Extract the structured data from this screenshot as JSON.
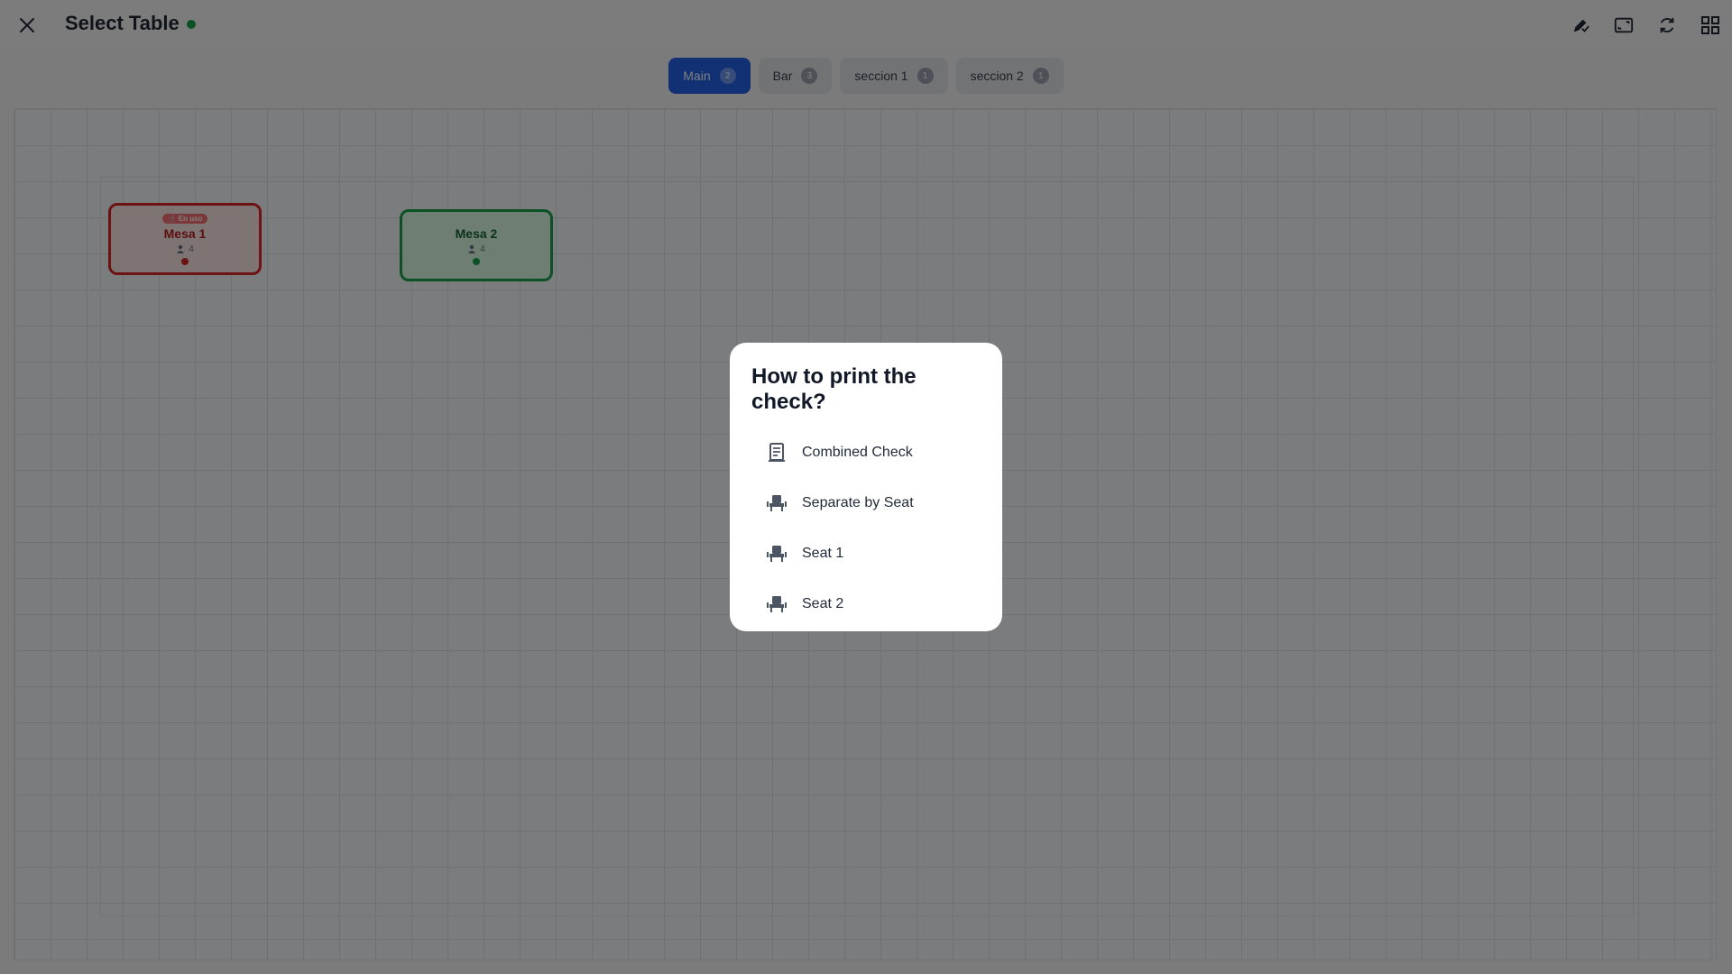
{
  "appbar": {
    "title": "Select Table",
    "status_color": "#16a34a",
    "actions": [
      "pencil-check-icon",
      "fullscreen-icon",
      "refresh-icon",
      "grid-view-icon"
    ]
  },
  "tabs": [
    {
      "label": "Main",
      "count": "2",
      "active": true
    },
    {
      "label": "Bar",
      "count": "3",
      "active": false
    },
    {
      "label": "seccion 1",
      "count": "1",
      "active": false
    },
    {
      "label": "seccion 2",
      "count": "1",
      "active": false
    }
  ],
  "tables": [
    {
      "name": "Mesa 1",
      "badge": "En uso",
      "seats": "4",
      "status": "busy"
    },
    {
      "name": "Mesa 2",
      "badge": "",
      "seats": "4",
      "status": "free"
    }
  ],
  "dialog": {
    "title": "How to print the check?",
    "options": [
      {
        "label": "Combined Check",
        "icon": "receipt-icon"
      },
      {
        "label": "Separate by Seat",
        "icon": "chair-icon"
      },
      {
        "label": "Seat 1",
        "icon": "chair-icon"
      },
      {
        "label": "Seat 2",
        "icon": "chair-icon"
      }
    ]
  },
  "colors": {
    "accent": "#2563eb",
    "busy": "#dc2626",
    "free": "#16a34a"
  }
}
